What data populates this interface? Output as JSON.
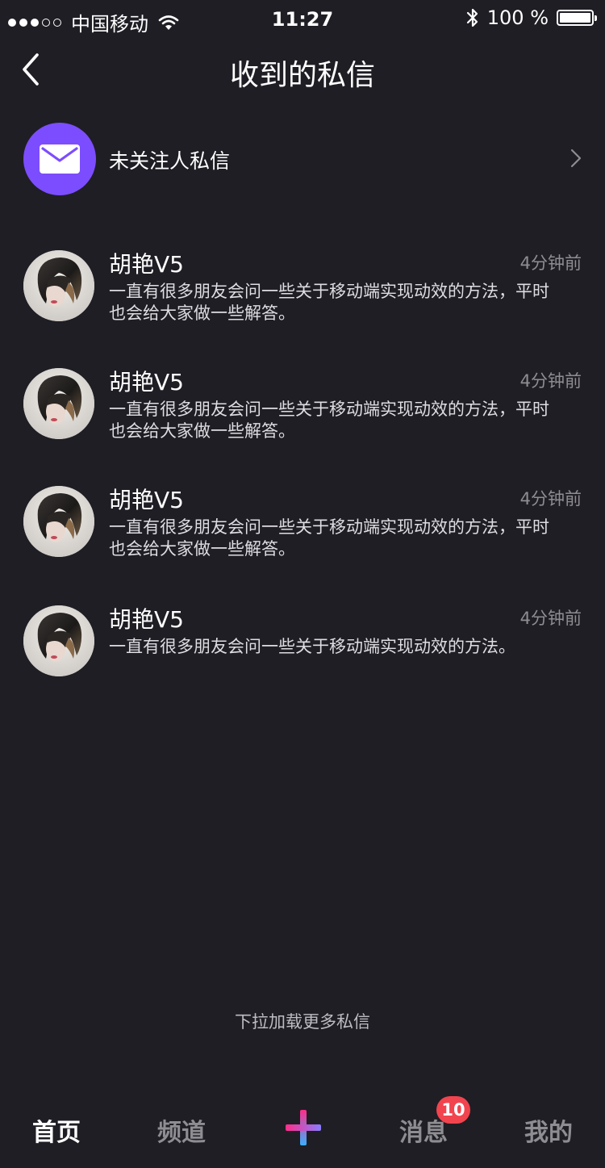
{
  "status_bar": {
    "carrier": "中国移动",
    "time": "11:27",
    "battery_percent": "100 %",
    "battery_level": 1.0,
    "signal_bars_filled": 3,
    "signal_bars_total": 5
  },
  "header": {
    "title": "收到的私信"
  },
  "stranger_messages": {
    "label": "未关注人私信",
    "icon": "envelope-icon",
    "accent_color": "#7c4dff"
  },
  "messages": [
    {
      "name": "胡艳V5",
      "time": "4分钟前",
      "preview": "一直有很多朋友会问一些关于移动端实现动效的方法，平时也会给大家做一些解答。"
    },
    {
      "name": "胡艳V5",
      "time": "4分钟前",
      "preview": "一直有很多朋友会问一些关于移动端实现动效的方法，平时也会给大家做一些解答。"
    },
    {
      "name": "胡艳V5",
      "time": "4分钟前",
      "preview": "一直有很多朋友会问一些关于移动端实现动效的方法，平时也会给大家做一些解答。"
    },
    {
      "name": "胡艳V5",
      "time": "4分钟前",
      "preview": "一直有很多朋友会问一些关于移动端实现动效的方法。"
    }
  ],
  "load_more": "下拉加载更多私信",
  "tab_bar": {
    "home": "首页",
    "channels": "频道",
    "messages": "消息",
    "messages_badge": "10",
    "me": "我的",
    "badge_color": "#f2444e"
  },
  "colors": {
    "background": "#1f1e24",
    "secondary_text": "#8e8d92"
  }
}
